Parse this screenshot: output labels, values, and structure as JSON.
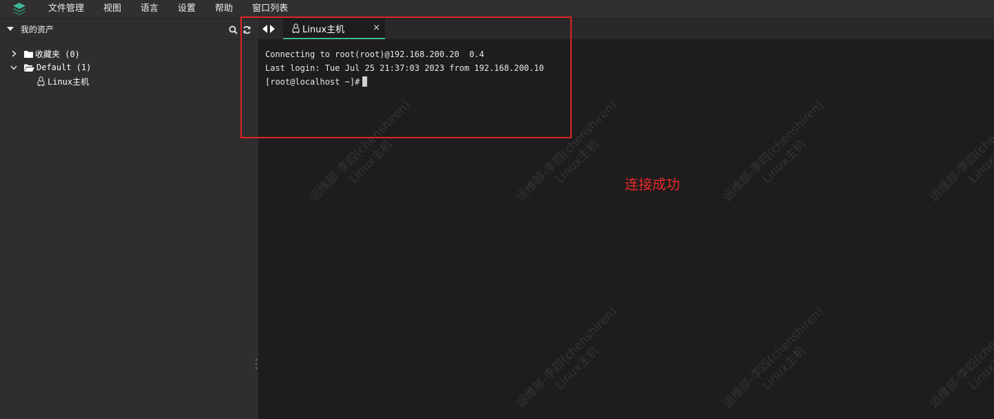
{
  "menubar": {
    "items": [
      "文件管理",
      "视图",
      "语言",
      "设置",
      "帮助",
      "窗口列表"
    ]
  },
  "sidebar": {
    "title": "我的资产",
    "tree": [
      {
        "label": "收藏夹 (0)",
        "expanded": false
      },
      {
        "label": "Default (1)",
        "expanded": true
      },
      {
        "label": "Linux主机",
        "leaf": true
      }
    ]
  },
  "tabs": [
    {
      "label": "Linux主机",
      "close": "×",
      "active": true
    }
  ],
  "terminal": {
    "lines": [
      "Connecting to root(root)@192.168.200.20  0.4",
      "Last login: Tue Jul 25 21:37:03 2023 from 192.168.200.10",
      "[root@localhost ~]#"
    ]
  },
  "annotation": "连接成功",
  "watermark": {
    "line1": "运维部-李四(chenshiren)",
    "line2": "Linux主机"
  },
  "colors": {
    "accent": "#3fb89a",
    "annotation": "#e82a2a",
    "background": "#1e1c1c",
    "sidebar": "#2f2d2d",
    "menubar": "#312f2f"
  }
}
